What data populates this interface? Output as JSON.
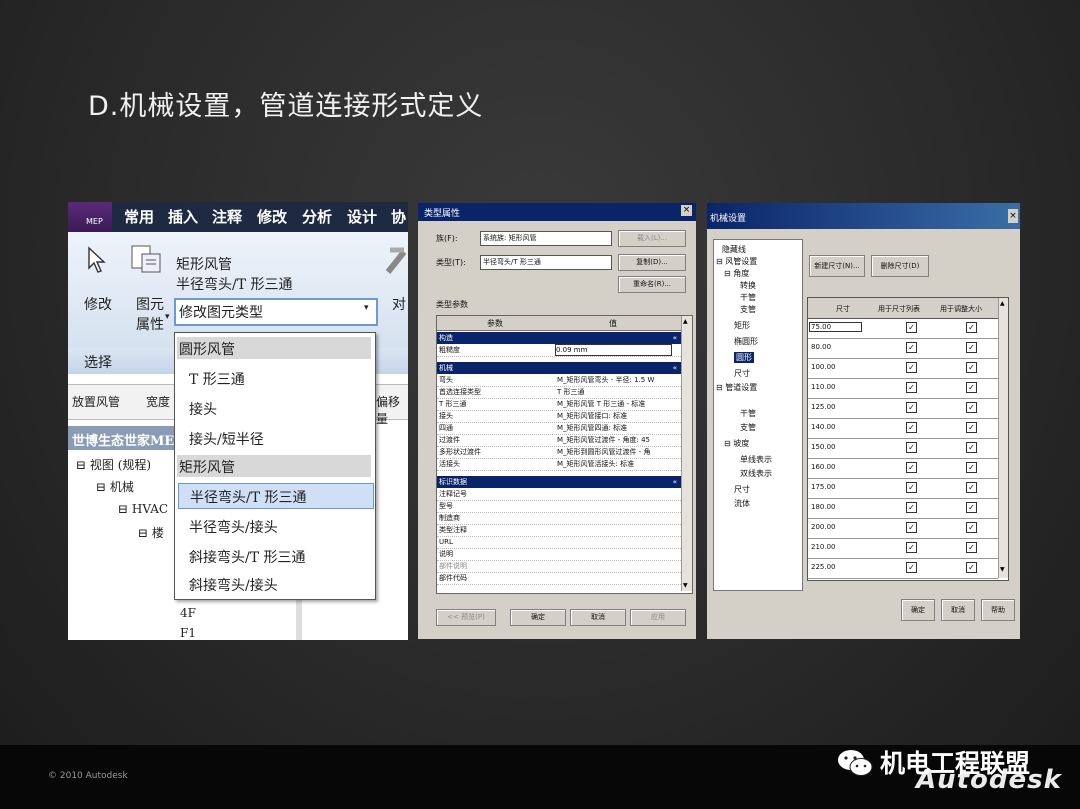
{
  "slide": {
    "title": "D.机械设置，管道连接形式定义",
    "copyright": "© 2010 Autodesk",
    "brand": "机电工程联盟",
    "autodesk": "Autodesk"
  },
  "panel1": {
    "logo": "MEP",
    "tabs": [
      "常用",
      "插入",
      "注释",
      "修改",
      "分析",
      "设计",
      "协"
    ],
    "modify_label": "修改",
    "elem_prop_line1": "图元",
    "elem_prop_line2": "属性",
    "family_name": "矩形风管",
    "type_name": "半径弯头/T 形三通",
    "combo_text": "修改图元类型",
    "align_label": "对",
    "select_label": "选择",
    "toolbar_items": [
      "放置风管",
      "宽度",
      "偏移量"
    ],
    "project_header": "世博生态世家MEP",
    "tree": [
      "视图 (规程)",
      "机械",
      "HVAC",
      "楼",
      "4F",
      "F1"
    ],
    "dropdown": {
      "group1": "圆形风管",
      "group1_items": [
        "T 形三通",
        "接头",
        "接头/短半径"
      ],
      "group2": "矩形风管",
      "group2_items": [
        "半径弯头/T 形三通",
        "半径弯头/接头",
        "斜接弯头/T 形三通",
        "斜接弯头/接头"
      ]
    }
  },
  "panel2": {
    "title": "类型属性",
    "family_label": "族(F):",
    "family_value": "系统族: 矩形风管",
    "type_label": "类型(T):",
    "type_value": "半径弯头/T 形三通",
    "load_btn": "载入(L)...",
    "dup_btn": "复制(D)...",
    "rename_btn": "重命名(R)...",
    "type_params": "类型参数",
    "col_param": "参数",
    "col_value": "值",
    "sec_construct": "构造",
    "roughness_label": "粗糙度",
    "roughness_value": "0.09 mm",
    "sec_mech": "机械",
    "mech_rows": [
      [
        "弯头",
        "M_矩形风管弯头 - 半径: 1.5 W"
      ],
      [
        "首选连接类型",
        "T 形三通"
      ],
      [
        "T 形三通",
        "M_矩形风管 T 形三通 - 标准"
      ],
      [
        "接头",
        "M_矩形风管接口: 标准"
      ],
      [
        "四通",
        "M_矩形风管四通: 标准"
      ],
      [
        "过渡件",
        "M_矩形风管过渡件 - 角度: 45"
      ],
      [
        "多形状过渡件",
        "M_矩形到圆形风管过渡件 - 角"
      ],
      [
        "活接头",
        "M_矩形风管活接头: 标准"
      ]
    ],
    "sec_id": "标识数据",
    "id_rows": [
      "注释记号",
      "型号",
      "制造商",
      "类型注释",
      "URL",
      "说明",
      "部件说明",
      "部件代码"
    ],
    "preview_btn": "<< 预览(P)",
    "ok_btn": "确定",
    "cancel_btn": "取消",
    "apply_btn": "应用"
  },
  "panel3": {
    "title": "机械设置",
    "tree": [
      "隐藏线",
      "风管设置",
      "角度",
      "转换",
      "干管",
      "支管",
      "矩形",
      "椭圆形",
      "圆形",
      "尺寸",
      "管道设置",
      "干管",
      "支管",
      "坡度",
      "单线表示",
      "双线表示",
      "尺寸",
      "流体"
    ],
    "new_size_btn": "新建尺寸(N)...",
    "delete_size_btn": "删除尺寸(D)",
    "col_size": "尺寸",
    "col_use_in_list": "用于尺寸列表",
    "col_use_in_sizing": "用于调整大小",
    "sizes": [
      "75.00",
      "80.00",
      "100.00",
      "110.00",
      "125.00",
      "140.00",
      "150.00",
      "160.00",
      "175.00",
      "180.00",
      "200.00",
      "210.00",
      "225.00"
    ],
    "ok_btn": "确定",
    "cancel_btn": "取消",
    "help_btn": "帮助"
  }
}
